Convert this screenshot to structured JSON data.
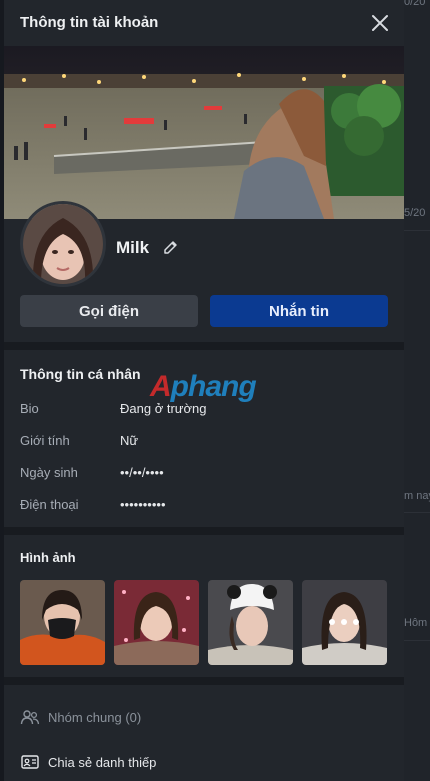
{
  "background_snippets": [
    "0/20",
    "5/20",
    "m nay",
    "Hôm"
  ],
  "panel": {
    "title": "Thông tin tài khoản",
    "close_icon": "close-icon"
  },
  "profile": {
    "name": "Milk",
    "edit_icon": "pencil-icon"
  },
  "actions": {
    "call": "Gọi điện",
    "message": "Nhắn tin"
  },
  "personal_info": {
    "title": "Thông tin cá nhân",
    "rows": [
      {
        "label": "Bio",
        "value": "Đang ở trường"
      },
      {
        "label": "Giới tính",
        "value": "Nữ"
      },
      {
        "label": "Ngày sinh",
        "value": "••/••/••••"
      },
      {
        "label": "Điện thoại",
        "value": "••••••••••"
      }
    ]
  },
  "watermark": {
    "first": "A",
    "rest": "phang"
  },
  "photos": {
    "title": "Hình ảnh",
    "count": 4
  },
  "options": {
    "groups": "Nhóm chung (0)",
    "share": "Chia sẻ danh thiếp"
  },
  "colors": {
    "panel_bg": "#22262c",
    "primary_button": "#0b3a91",
    "secondary_button": "#3a3f47",
    "watermark_red": "#e02b2b",
    "watermark_blue": "#1f8fd6"
  }
}
